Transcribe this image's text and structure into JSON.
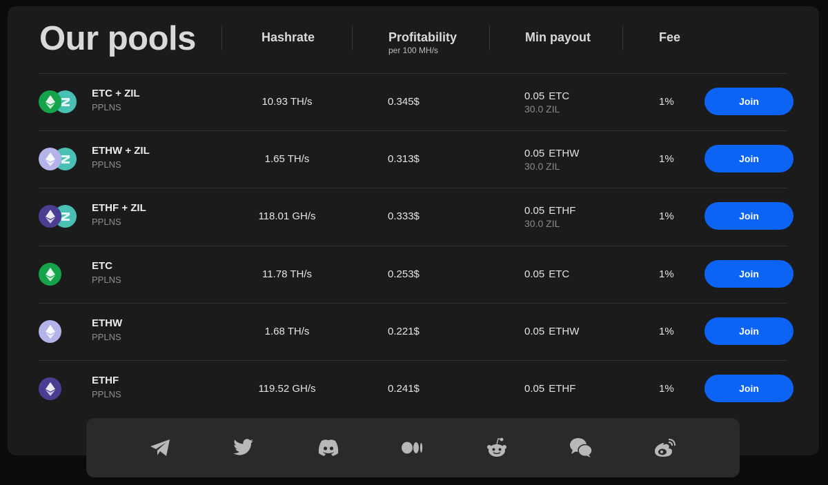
{
  "header": {
    "title": "Our pools",
    "columns": {
      "hashrate": "Hashrate",
      "profitability": "Profitability",
      "profitability_sub": "per 100 MH/s",
      "min_payout": "Min payout",
      "fee": "Fee"
    }
  },
  "pools": [
    {
      "name": "ETC + ZIL",
      "type": "PPLNS",
      "coins": [
        "etc",
        "zil"
      ],
      "hashrate": "10.93 TH/s",
      "profitability": "0.345$",
      "min_amount": "0.05",
      "min_unit": "ETC",
      "min_extra": "30.0 ZIL",
      "fee": "1%",
      "join_label": "Join"
    },
    {
      "name": "ETHW + ZIL",
      "type": "PPLNS",
      "coins": [
        "ethw",
        "zil"
      ],
      "hashrate": "1.65 TH/s",
      "profitability": "0.313$",
      "min_amount": "0.05",
      "min_unit": "ETHW",
      "min_extra": "30.0 ZIL",
      "fee": "1%",
      "join_label": "Join"
    },
    {
      "name": "ETHF + ZIL",
      "type": "PPLNS",
      "coins": [
        "ethf",
        "zil"
      ],
      "hashrate": "118.01 GH/s",
      "profitability": "0.333$",
      "min_amount": "0.05",
      "min_unit": "ETHF",
      "min_extra": "30.0 ZIL",
      "fee": "1%",
      "join_label": "Join"
    },
    {
      "name": "ETC",
      "type": "PPLNS",
      "coins": [
        "etc"
      ],
      "hashrate": "11.78 TH/s",
      "profitability": "0.253$",
      "min_amount": "0.05",
      "min_unit": "ETC",
      "min_extra": "",
      "fee": "1%",
      "join_label": "Join"
    },
    {
      "name": "ETHW",
      "type": "PPLNS",
      "coins": [
        "ethw"
      ],
      "hashrate": "1.68 TH/s",
      "profitability": "0.221$",
      "min_amount": "0.05",
      "min_unit": "ETHW",
      "min_extra": "",
      "fee": "1%",
      "join_label": "Join"
    },
    {
      "name": "ETHF",
      "type": "PPLNS",
      "coins": [
        "ethf"
      ],
      "hashrate": "119.52 GH/s",
      "profitability": "0.241$",
      "min_amount": "0.05",
      "min_unit": "ETHF",
      "min_extra": "",
      "fee": "1%",
      "join_label": "Join"
    }
  ],
  "coin_colors": {
    "etc": "#14a34a",
    "ethw": "#b4b3ea",
    "ethf": "#4b3e92",
    "zil": "#49c0b3"
  },
  "accent": "#0b64f4",
  "social": [
    "telegram-icon",
    "twitter-icon",
    "discord-icon",
    "medium-icon",
    "reddit-icon",
    "wechat-icon",
    "weibo-icon"
  ]
}
